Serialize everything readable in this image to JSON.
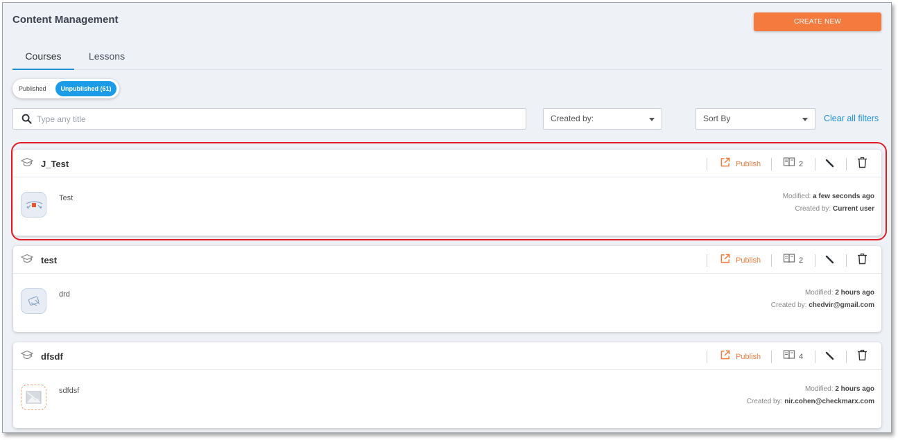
{
  "page": {
    "title": "Content Management",
    "create_label": "CREATE NEW"
  },
  "tabs": [
    {
      "label": "Courses",
      "active": true
    },
    {
      "label": "Lessons",
      "active": false
    }
  ],
  "toggle": {
    "published": "Published",
    "unpublished": "Unpublished (61)"
  },
  "filters": {
    "search_placeholder": "Type any title",
    "created_by": "Created by:",
    "sort_by": "Sort By",
    "clear_label": "Clear all filters"
  },
  "colors": {
    "accent": "#f47a3d",
    "primary": "#1c9be6",
    "highlight": "#e01b24"
  },
  "courses": [
    {
      "title": "J_Test",
      "publish_label": "Publish",
      "lesson_count": "2",
      "description": "Test",
      "modified_label": "Modified",
      "modified": "a few seconds ago",
      "created_label": "Created by",
      "created_by": "Current user",
      "highlighted": true
    },
    {
      "title": "test",
      "publish_label": "Publish",
      "lesson_count": "2",
      "description": "drd",
      "modified_label": "Modified",
      "modified": "2 hours ago",
      "created_label": "Created by",
      "created_by": "chedvir@gmail.com"
    },
    {
      "title": "dfsdf",
      "publish_label": "Publish",
      "lesson_count": "4",
      "description": "sdfdsf",
      "modified_label": "Modified",
      "modified": "2 hours ago",
      "created_label": "Created by",
      "created_by": "nir.cohen@checkmarx.com"
    }
  ]
}
